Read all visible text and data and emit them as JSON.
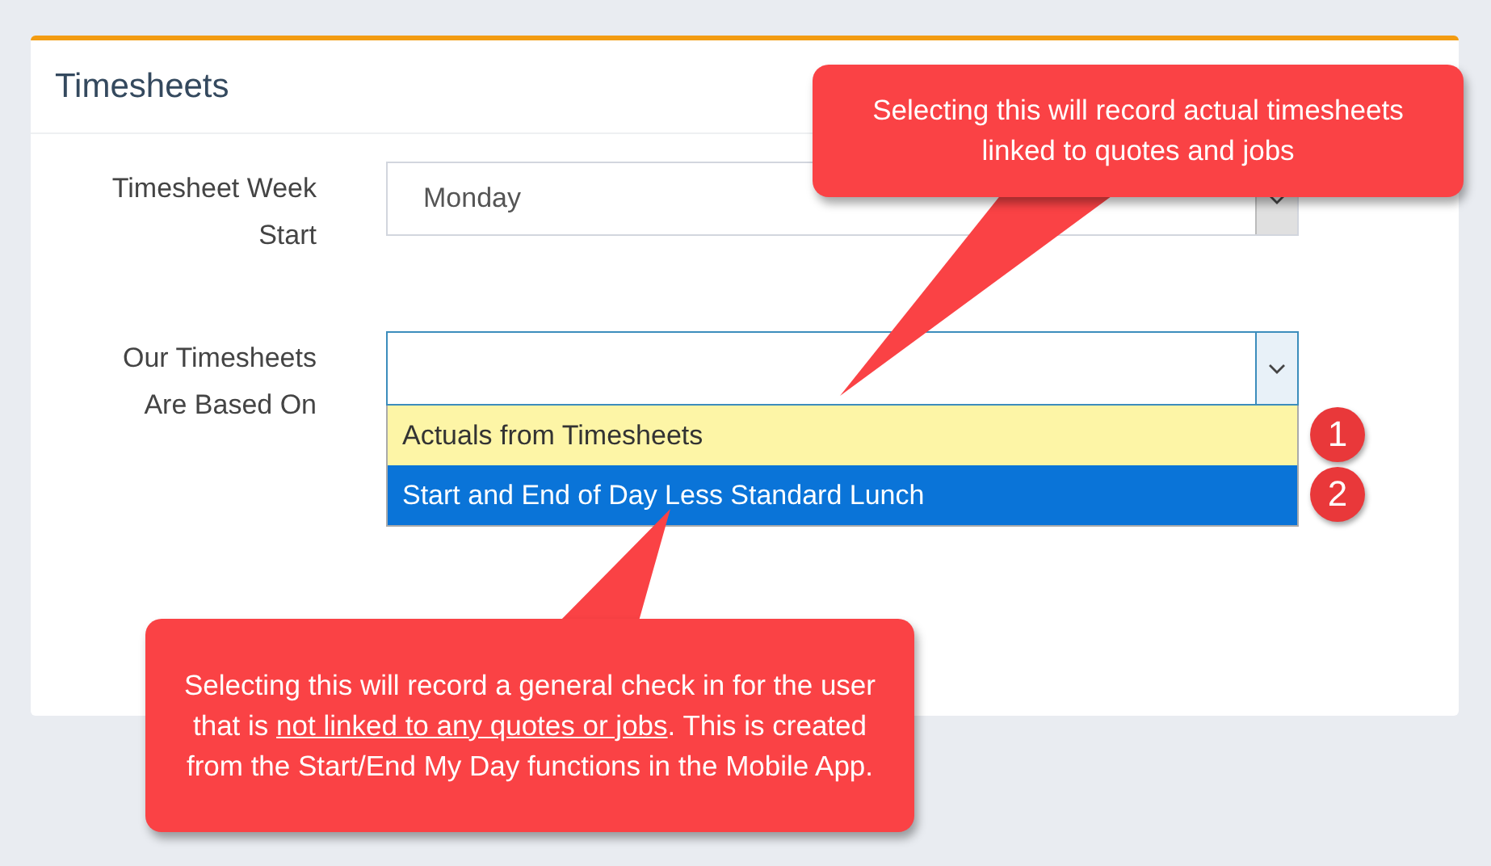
{
  "panel": {
    "title": "Timesheets"
  },
  "fields": [
    {
      "label": "Timesheet Week Start",
      "value": "Monday",
      "focused": false,
      "open": false
    },
    {
      "label": "Our Timesheets Are Based On",
      "focused": true,
      "open": true
    }
  ],
  "dropdown_options": [
    {
      "label": "Actuals from Timesheets",
      "selected": false,
      "highlighted": true,
      "badge": "1"
    },
    {
      "label": "Start and End of Day Less Standard Lunch",
      "selected": true,
      "highlighted": false,
      "badge": "2"
    }
  ],
  "callouts": [
    {
      "kind": "top",
      "segments": [
        {
          "text": "Selecting this will record actual timesheets linked to quotes and jobs",
          "underlined": false
        }
      ]
    },
    {
      "kind": "bottom",
      "segments": [
        {
          "text": "Selecting this will record a general check in for the user that is ",
          "underlined": false
        },
        {
          "text": "not linked to any quotes or jobs",
          "underlined": true
        },
        {
          "text": ". This is created from the Start/End My Day functions in the Mobile App.",
          "underlined": false
        }
      ]
    }
  ]
}
